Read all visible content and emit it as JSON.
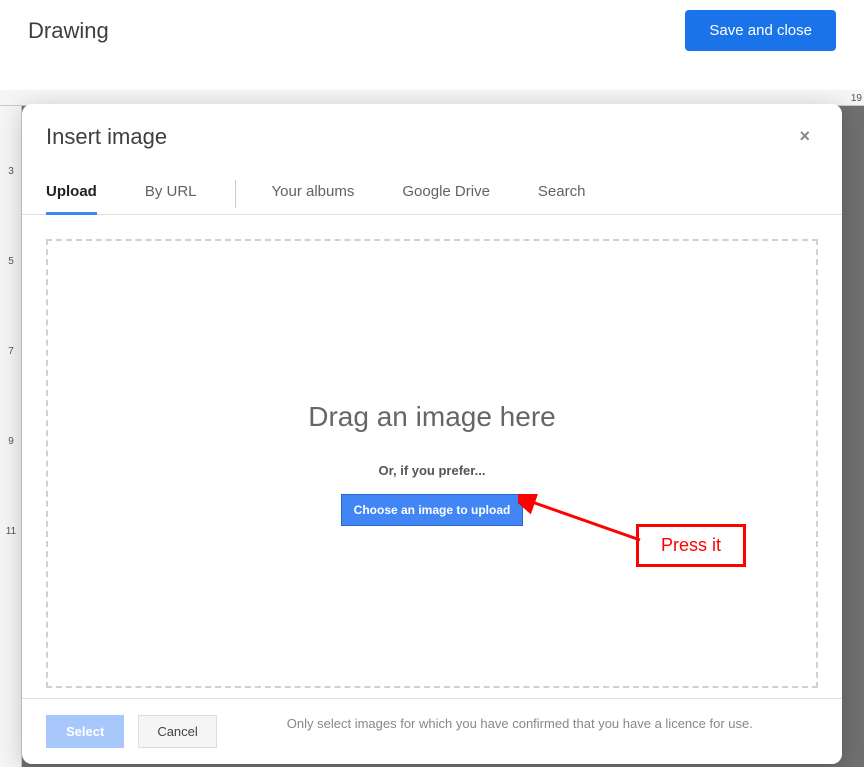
{
  "header": {
    "title": "Drawing",
    "save_close": "Save and close"
  },
  "ruler_h_right": "19",
  "ruler_v_ticks": [
    "",
    "",
    "",
    "3",
    "",
    "5",
    "",
    "7",
    "",
    "9",
    "",
    "11"
  ],
  "modal": {
    "title": "Insert image",
    "close": "×",
    "tabs": {
      "upload": "Upload",
      "by_url": "By URL",
      "your_albums": "Your albums",
      "google_drive": "Google Drive",
      "search": "Search"
    },
    "drop": {
      "drag_text": "Drag an image here",
      "or_text": "Or, if you prefer...",
      "choose_btn": "Choose an image to upload"
    },
    "footer": {
      "select": "Select",
      "cancel": "Cancel",
      "licence": "Only select images for which you have confirmed that you have a licence for use."
    }
  },
  "annotation": {
    "label": "Press it"
  }
}
